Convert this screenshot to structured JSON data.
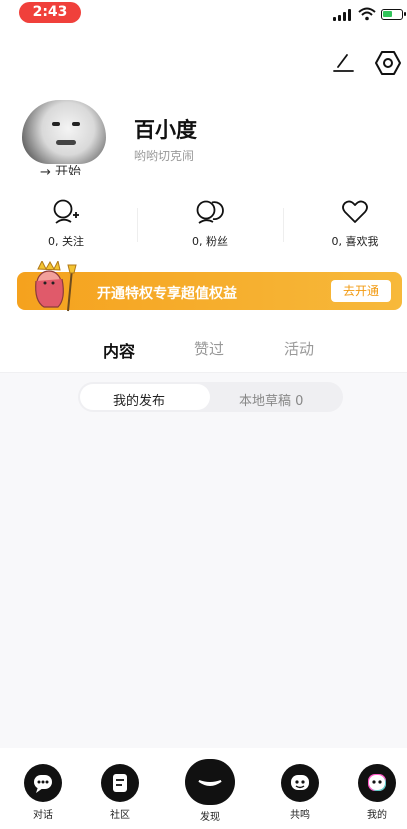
{
  "status_bar": {
    "time": "2:43"
  },
  "profile": {
    "username": "百小度",
    "bio": "哟哟切克闹",
    "cut_text": "→ 开始"
  },
  "stats": [
    {
      "label": "0, 关注",
      "icon": "add-user-icon"
    },
    {
      "label": "0, 粉丝",
      "icon": "users-icon"
    },
    {
      "label": "0, 喜欢我",
      "icon": "heart-icon"
    }
  ],
  "vip": {
    "text": "开通特权专享超值权益",
    "button": "去开通"
  },
  "tabs": [
    {
      "label": "内容",
      "active": true
    },
    {
      "label": "赞过",
      "active": false
    },
    {
      "label": "活动",
      "active": false
    }
  ],
  "segments": [
    {
      "label": "我的发布",
      "active": true
    },
    {
      "label": "本地草稿 0",
      "active": false
    }
  ],
  "bottom_nav": [
    {
      "label": "对话",
      "icon": "chat-icon"
    },
    {
      "label": "社区",
      "icon": "community-icon"
    },
    {
      "label": "发现",
      "icon": "discover-icon"
    },
    {
      "label": "共鸣",
      "icon": "resonance-icon"
    },
    {
      "label": "我的",
      "icon": "profile-icon"
    }
  ],
  "colors": {
    "accent": "#f5a21e",
    "time_pill": "#f0403b",
    "battery": "#31c45a"
  }
}
